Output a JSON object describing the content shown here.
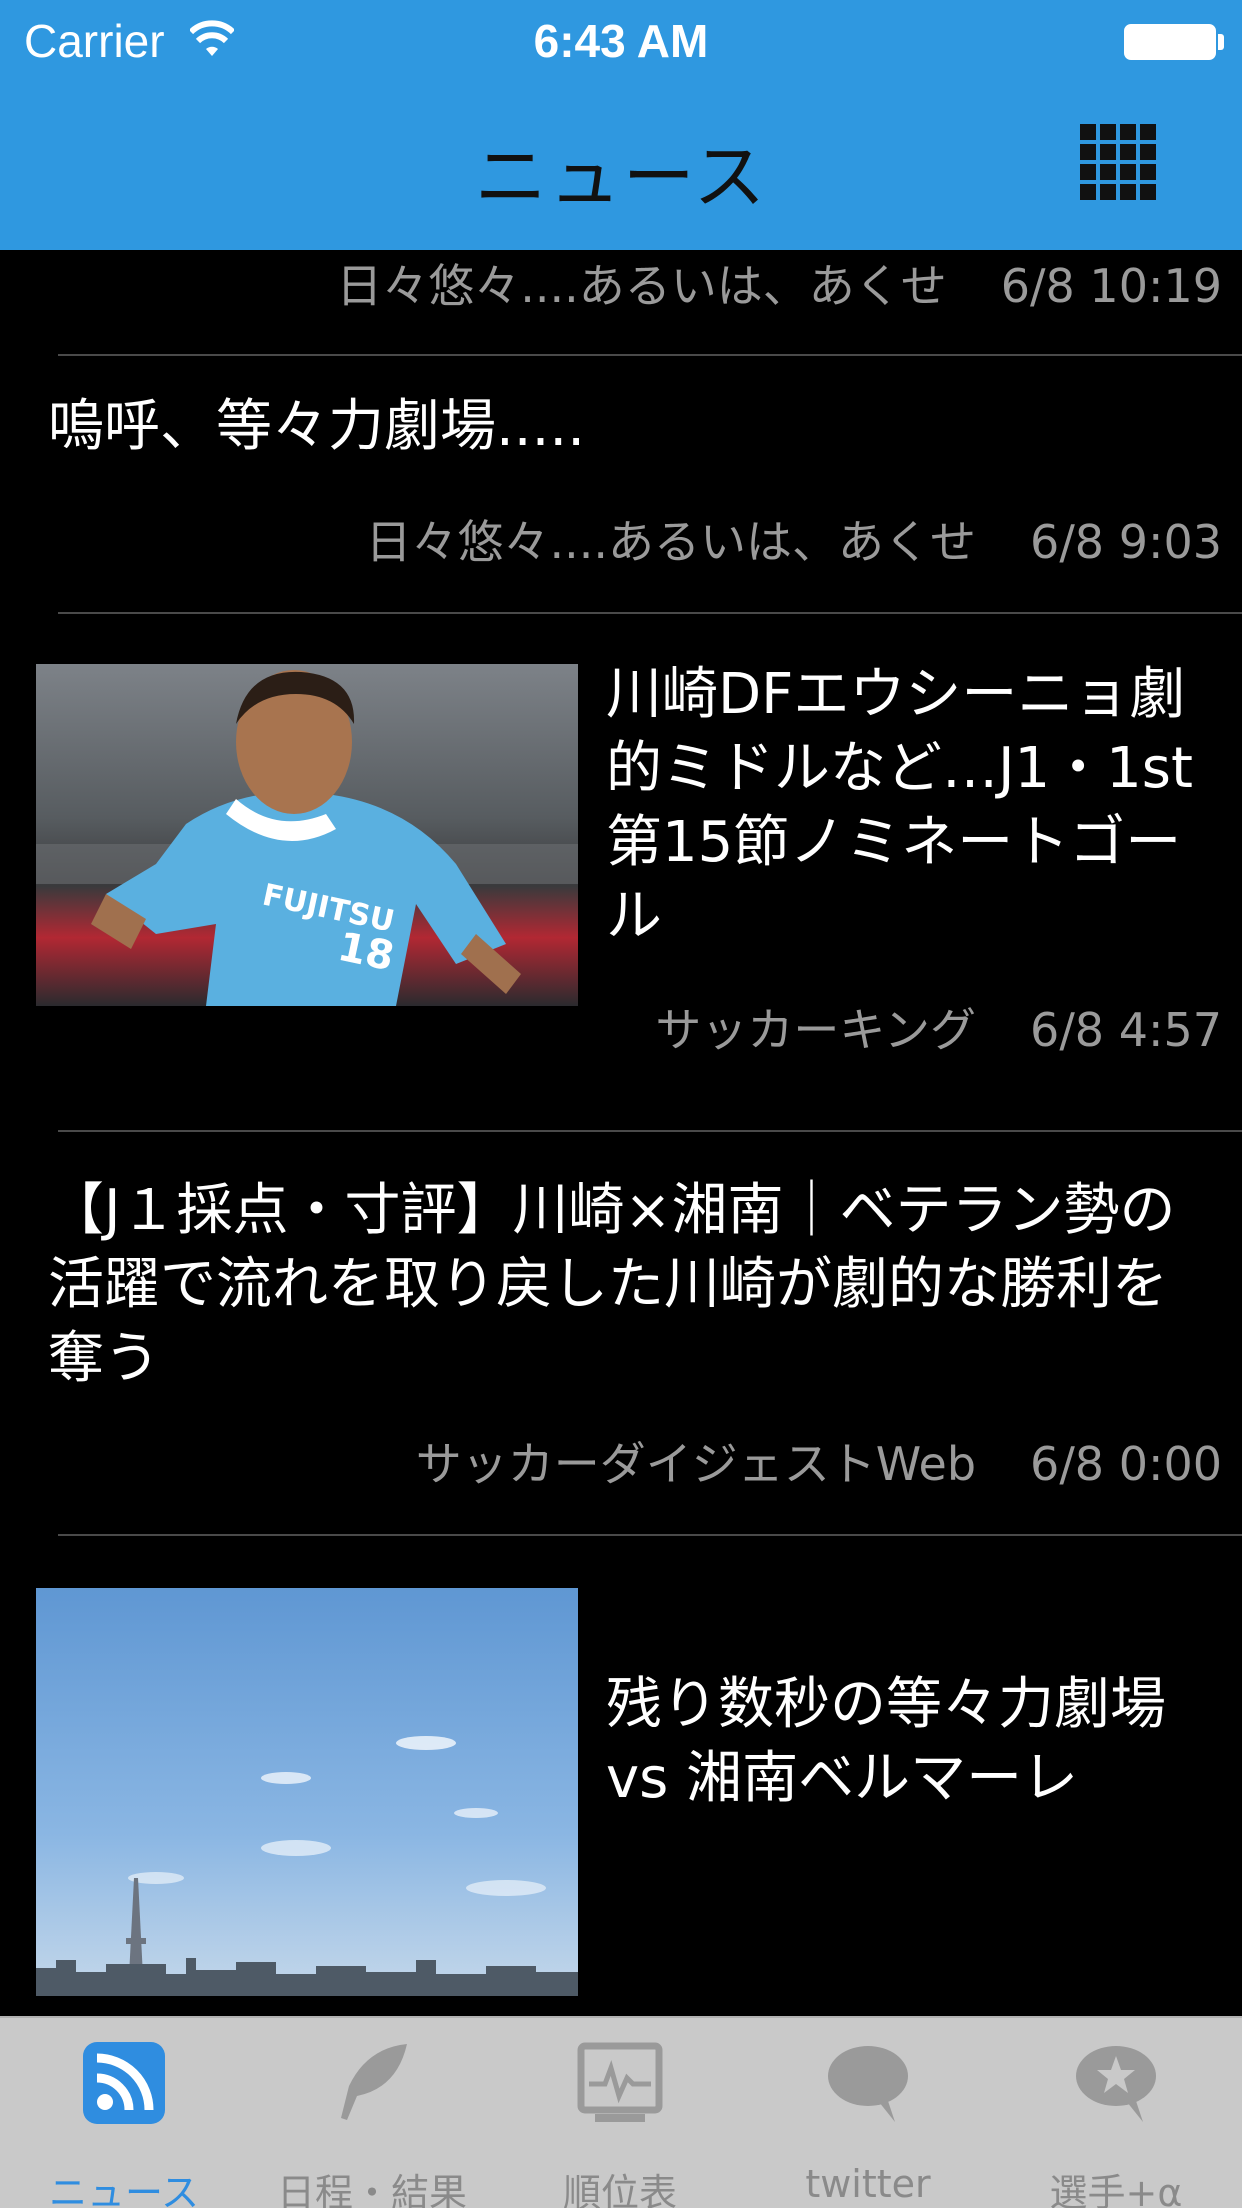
{
  "status_bar": {
    "carrier": "Carrier",
    "time": "6:43 AM"
  },
  "nav": {
    "title": "ニュース",
    "grid_icon": "grid-menu-icon"
  },
  "news": [
    {
      "title": "",
      "source": "日々悠々....あるいは、あくせ",
      "time": "6/8 10:19"
    },
    {
      "title": "嗚呼、等々力劇場.....",
      "source": "日々悠々....あるいは、あくせ",
      "time": "6/8 9:03"
    },
    {
      "title": "川崎DFエウシーニョ劇的ミドルなど…J1・1st第15節ノミネートゴール",
      "source": "サッカーキング",
      "time": "6/8 4:57"
    },
    {
      "title": "【J１採点・寸評】川崎×湘南｜ベテラン勢の活躍で流れを取り戻した川崎が劇的な勝利を奪う",
      "source": "サッカーダイジェストWeb",
      "time": "6/8 0:00"
    },
    {
      "title": "残り数秒の等々力劇場　vs 湘南ベルマーレ",
      "source": "",
      "time": ""
    }
  ],
  "tabs": [
    {
      "label": "ニュース",
      "icon": "rss-icon",
      "active": true
    },
    {
      "label": "日程・結果",
      "icon": "feather-icon",
      "active": false
    },
    {
      "label": "順位表",
      "icon": "chart-monitor-icon",
      "active": false
    },
    {
      "label": "twitter",
      "icon": "speech-bubble-icon",
      "active": false
    },
    {
      "label": "選手+α",
      "icon": "star-bubble-icon",
      "active": false
    }
  ],
  "colors": {
    "nav_bar": "#2f98e0",
    "tab_active": "#2f8de0",
    "tab_inactive": "#8a8a8a",
    "background": "#000000"
  }
}
